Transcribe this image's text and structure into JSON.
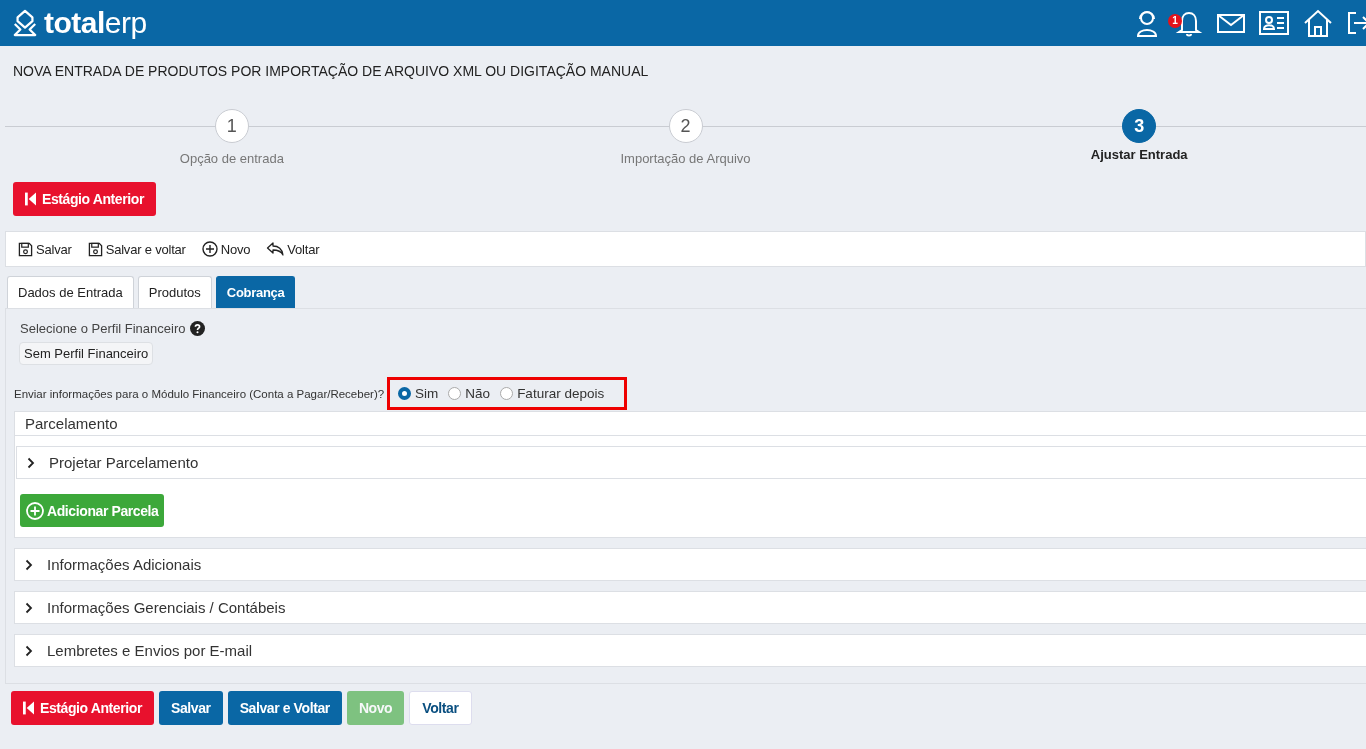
{
  "header": {
    "logo": "**total**erp",
    "notification_count": "1"
  },
  "page_title": "NOVA ENTRADA DE PRODUTOS POR IMPORTAÇÃO DE ARQUIVO XML OU DIGITAÇÃO MANUAL",
  "steps": [
    {
      "number": "1",
      "label": "Opção de entrada",
      "selected": false
    },
    {
      "number": "2",
      "label": "Importação de Arquivo",
      "selected": false
    },
    {
      "number": "3",
      "label": "Ajustar Entrada",
      "selected": true
    }
  ],
  "back_button": "Estágio Anterior",
  "toolbar": [
    {
      "kind": "save",
      "label": "Salvar"
    },
    {
      "kind": "save",
      "label": "Salvar e voltar"
    },
    {
      "kind": "add",
      "label": "Novo"
    },
    {
      "kind": "back",
      "label": "Voltar"
    }
  ],
  "tabs": [
    {
      "label": "Dados de Entrada",
      "selected": false
    },
    {
      "label": "Produtos",
      "selected": false
    },
    {
      "label": "Cobrança",
      "selected": true
    }
  ],
  "profile": {
    "label": "Selecione o Perfil Financeiro",
    "value": "Sem Perfil Financeiro"
  },
  "send_question": {
    "label": "Enviar informações para o Módulo Financeiro (Conta a Pagar/Receber)?",
    "highlighted": true,
    "options": [
      {
        "label": "Sim",
        "selected": true
      },
      {
        "label": "Não",
        "selected": false
      },
      {
        "label": "Faturar depois",
        "selected": false
      }
    ]
  },
  "installments": {
    "title": "Parcelamento",
    "projection": {
      "label": "Projetar Parcelamento",
      "expanded": false
    },
    "add_button": "Adicionar Parcela"
  },
  "sections": [
    {
      "label": "Informações Adicionais",
      "expanded": false
    },
    {
      "label": "Informações Gerenciais / Contábeis",
      "expanded": false
    },
    {
      "label": "Lembretes e Envios por E-mail",
      "expanded": false
    }
  ],
  "footer_buttons": [
    {
      "kind": "danger",
      "label": "Estágio Anterior",
      "disabled": false
    },
    {
      "kind": "primary",
      "label": "Salvar",
      "disabled": false
    },
    {
      "kind": "primary",
      "label": "Salvar e Voltar",
      "disabled": false
    },
    {
      "kind": "success",
      "label": "Novo",
      "disabled": true
    },
    {
      "kind": "default",
      "label": "Voltar",
      "disabled": false
    }
  ]
}
